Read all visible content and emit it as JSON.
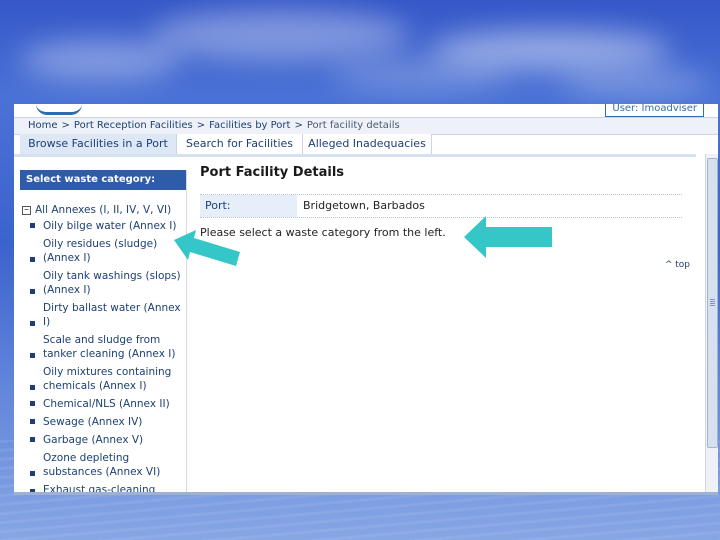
{
  "app": {
    "user_label": "User: Imoadviser"
  },
  "breadcrumb": {
    "items": [
      "Home",
      "Port Reception Facilities",
      "Facilities by Port",
      "Port facility details"
    ],
    "separator": ">"
  },
  "tabs": [
    {
      "label": "Browse Facilities in a Port",
      "active": true
    },
    {
      "label": "Search for Facilities",
      "active": false
    },
    {
      "label": "Alleged Inadequacies",
      "active": false
    }
  ],
  "sidebar": {
    "header": "Select waste category:",
    "root_label": "All Annexes (I, II, IV, V, VI)",
    "toggle_symbol": "−",
    "categories": [
      {
        "label": "Oily bilge water (Annex I)"
      },
      {
        "label": "Oily residues (sludge) (Annex I)"
      },
      {
        "label": "Oily tank washings (slops) (Annex I)"
      },
      {
        "label": "Dirty ballast water (Annex I)"
      },
      {
        "label": "Scale and sludge from tanker cleaning (Annex I)"
      },
      {
        "label": "Oily mixtures containing chemicals (Annex I)"
      },
      {
        "label": "Chemical/NLS (Annex II)"
      },
      {
        "label": "Sewage (Annex IV)"
      },
      {
        "label": "Garbage (Annex V)"
      },
      {
        "label": "Ozone depleting substances (Annex VI)"
      },
      {
        "label": "Exhaust gas-cleaning"
      }
    ]
  },
  "main": {
    "title": "Port Facility Details",
    "port_label": "Port:",
    "port_value": "Bridgetown, Barbados",
    "instruction": "Please select a waste category from the left.",
    "top_link": "^ top"
  },
  "colors": {
    "arrow": "#35c6c8",
    "sidebar_header": "#2e5ca8",
    "link": "#1d3f73"
  }
}
